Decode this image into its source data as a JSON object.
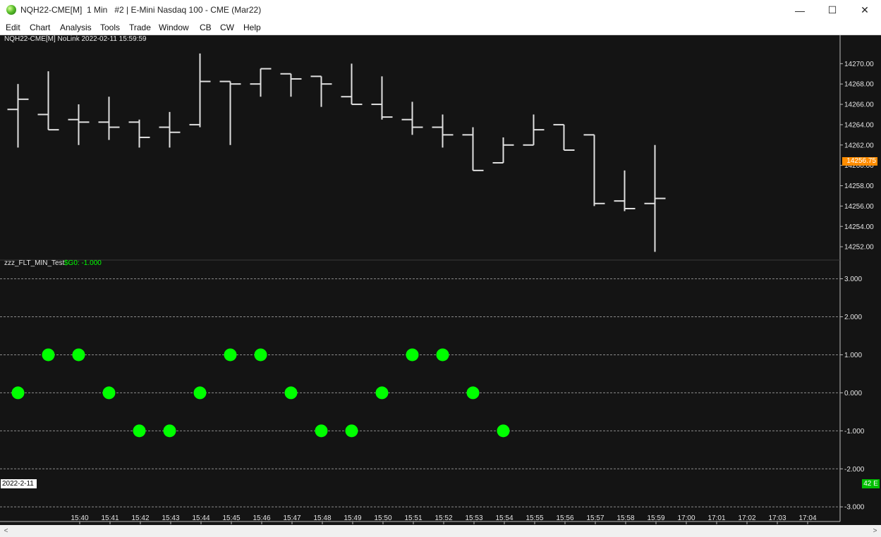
{
  "window": {
    "title": "NQH22-CME[M]  1 Min   #2 | E-Mini Nasdaq 100 - CME (Mar22)",
    "minimize": "—",
    "maximize": "☐",
    "close": "✕"
  },
  "menu": [
    "Edit",
    "Chart",
    "Analysis",
    "Tools",
    "Trade",
    "Window",
    "CB",
    "CW",
    "Help"
  ],
  "price_pane": {
    "header": "NQH22-CME[M] NoLink 2022-02-11 15:59:59",
    "last_price_label": "14256.75",
    "last_price_color": "#ff8c00"
  },
  "indicator_pane": {
    "name": "zzz_FLT_MIN_Test",
    "value_label": "$G0: -1.000",
    "marker_color": "#00ff00"
  },
  "time_axis": {
    "date_label": "2022-2-11",
    "bars_badge": "42 E"
  },
  "scrollbar": {
    "left_arrow": "<",
    "right_arrow": ">"
  },
  "chart_data": [
    {
      "type": "ohlc",
      "x_labels": [
        "15:40",
        "15:41",
        "15:42",
        "15:43",
        "15:44",
        "15:45",
        "15:46",
        "15:47",
        "15:48",
        "15:49",
        "15:50",
        "15:51",
        "15:52",
        "15:53",
        "15:54",
        "15:55",
        "15:56",
        "15:57",
        "15:58",
        "15:59",
        "17:00",
        "17:01",
        "17:02",
        "17:03",
        "17:04"
      ],
      "bars": [
        {
          "o": 14265.5,
          "h": 14268.0,
          "l": 14261.75,
          "c": 14266.5
        },
        {
          "o": 14265.0,
          "h": 14269.25,
          "l": 14263.5,
          "c": 14263.5
        },
        {
          "o": 14264.5,
          "h": 14266.0,
          "l": 14262.0,
          "c": 14264.25
        },
        {
          "o": 14264.25,
          "h": 14266.75,
          "l": 14262.5,
          "c": 14263.75
        },
        {
          "o": 14264.25,
          "h": 14264.5,
          "l": 14261.75,
          "c": 14262.75
        },
        {
          "o": 14263.75,
          "h": 14265.25,
          "l": 14261.75,
          "c": 14263.25
        },
        {
          "o": 14264.0,
          "h": 14271.0,
          "l": 14263.75,
          "c": 14268.25
        },
        {
          "o": 14268.25,
          "h": 14268.25,
          "l": 14262.0,
          "c": 14268.0
        },
        {
          "o": 14268.0,
          "h": 14269.5,
          "l": 14266.75,
          "c": 14269.5
        },
        {
          "o": 14269.0,
          "h": 14269.0,
          "l": 14266.75,
          "c": 14268.5
        },
        {
          "o": 14268.75,
          "h": 14268.75,
          "l": 14265.75,
          "c": 14268.0
        },
        {
          "o": 14266.75,
          "h": 14270.0,
          "l": 14266.0,
          "c": 14266.0
        },
        {
          "o": 14266.0,
          "h": 14268.75,
          "l": 14264.5,
          "c": 14264.75
        },
        {
          "o": 14264.5,
          "h": 14266.25,
          "l": 14263.0,
          "c": 14263.75
        },
        {
          "o": 14263.75,
          "h": 14265.0,
          "l": 14261.75,
          "c": 14263.0
        },
        {
          "o": 14263.0,
          "h": 14263.75,
          "l": 14259.5,
          "c": 14259.5
        },
        {
          "o": 14260.25,
          "h": 14262.75,
          "l": 14260.25,
          "c": 14262.0
        },
        {
          "o": 14262.0,
          "h": 14265.0,
          "l": 14262.0,
          "c": 14263.5
        },
        {
          "o": 14264.0,
          "h": 14264.0,
          "l": 14261.5,
          "c": 14261.5
        },
        {
          "o": 14263.0,
          "h": 14263.0,
          "l": 14256.0,
          "c": 14256.25
        },
        {
          "o": 14256.5,
          "h": 14259.5,
          "l": 14255.5,
          "c": 14255.75
        },
        {
          "o": 14256.25,
          "h": 14262.0,
          "l": 14251.5,
          "c": 14256.75
        }
      ],
      "ylim": [
        14250.9,
        14272.1
      ],
      "y_ticks": [
        "14252.00",
        "14254.00",
        "14256.00",
        "14258.00",
        "14260.00",
        "14262.00",
        "14264.00",
        "14266.00",
        "14268.00",
        "14270.00"
      ]
    },
    {
      "type": "scatter",
      "values": [
        0,
        1,
        1,
        0,
        -1,
        -1,
        0,
        1,
        1,
        0,
        -1,
        -1,
        0,
        1,
        1,
        0,
        -1
      ],
      "ylim": [
        -3.2,
        3.4
      ],
      "y_ticks": [
        "3.000",
        "2.000",
        "1.000",
        "0.000",
        "-1.000",
        "-2.000",
        "-3.000"
      ],
      "grid": true
    }
  ]
}
